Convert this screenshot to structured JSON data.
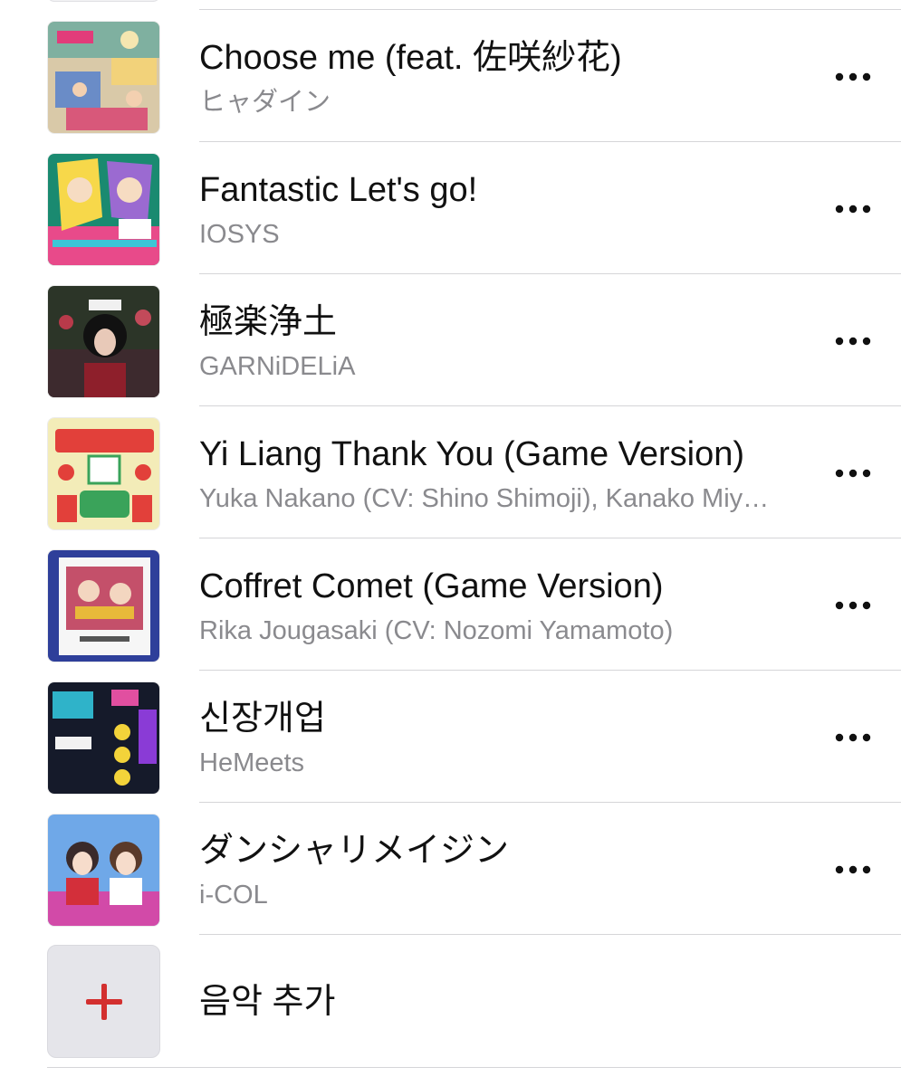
{
  "songs": [
    {
      "title": "Choose me (feat. 佐咲紗花)",
      "artist": "ヒャダイン",
      "artwork_icon": "album-art-hyadain",
      "more_icon": "ellipsis-icon"
    },
    {
      "title": "Fantastic Let's go!",
      "artist": "IOSYS",
      "artwork_icon": "album-art-iosys",
      "more_icon": "ellipsis-icon"
    },
    {
      "title": "極楽浄土",
      "artist": "GARNiDELiA",
      "artwork_icon": "album-art-garnidelia",
      "more_icon": "ellipsis-icon"
    },
    {
      "title": "Yi Liang Thank You (Game Version)",
      "artist": "Yuka Nakano (CV: Shino Shimoji), Kanako Miyamoto",
      "artwork_icon": "album-art-yi-liang",
      "more_icon": "ellipsis-icon"
    },
    {
      "title": "Coffret Comet (Game Version)",
      "artist": "Rika Jougasaki (CV: Nozomi Yamamoto)",
      "artwork_icon": "album-art-coffret-comet",
      "more_icon": "ellipsis-icon"
    },
    {
      "title": "신장개업",
      "artist": "HeMeets",
      "artwork_icon": "album-art-hemeets",
      "more_icon": "ellipsis-icon"
    },
    {
      "title": "ダンシャリメイジン",
      "artist": "i-COL",
      "artwork_icon": "album-art-i-col",
      "more_icon": "ellipsis-icon"
    }
  ],
  "add_music": {
    "label": "음악 추가",
    "icon": "plus-icon",
    "accent_color": "#d32f2f"
  },
  "colors": {
    "title_text": "#111111",
    "artist_text": "#8a8a8e",
    "divider": "#d5d5d8",
    "add_tile_bg": "#e5e5ea"
  }
}
